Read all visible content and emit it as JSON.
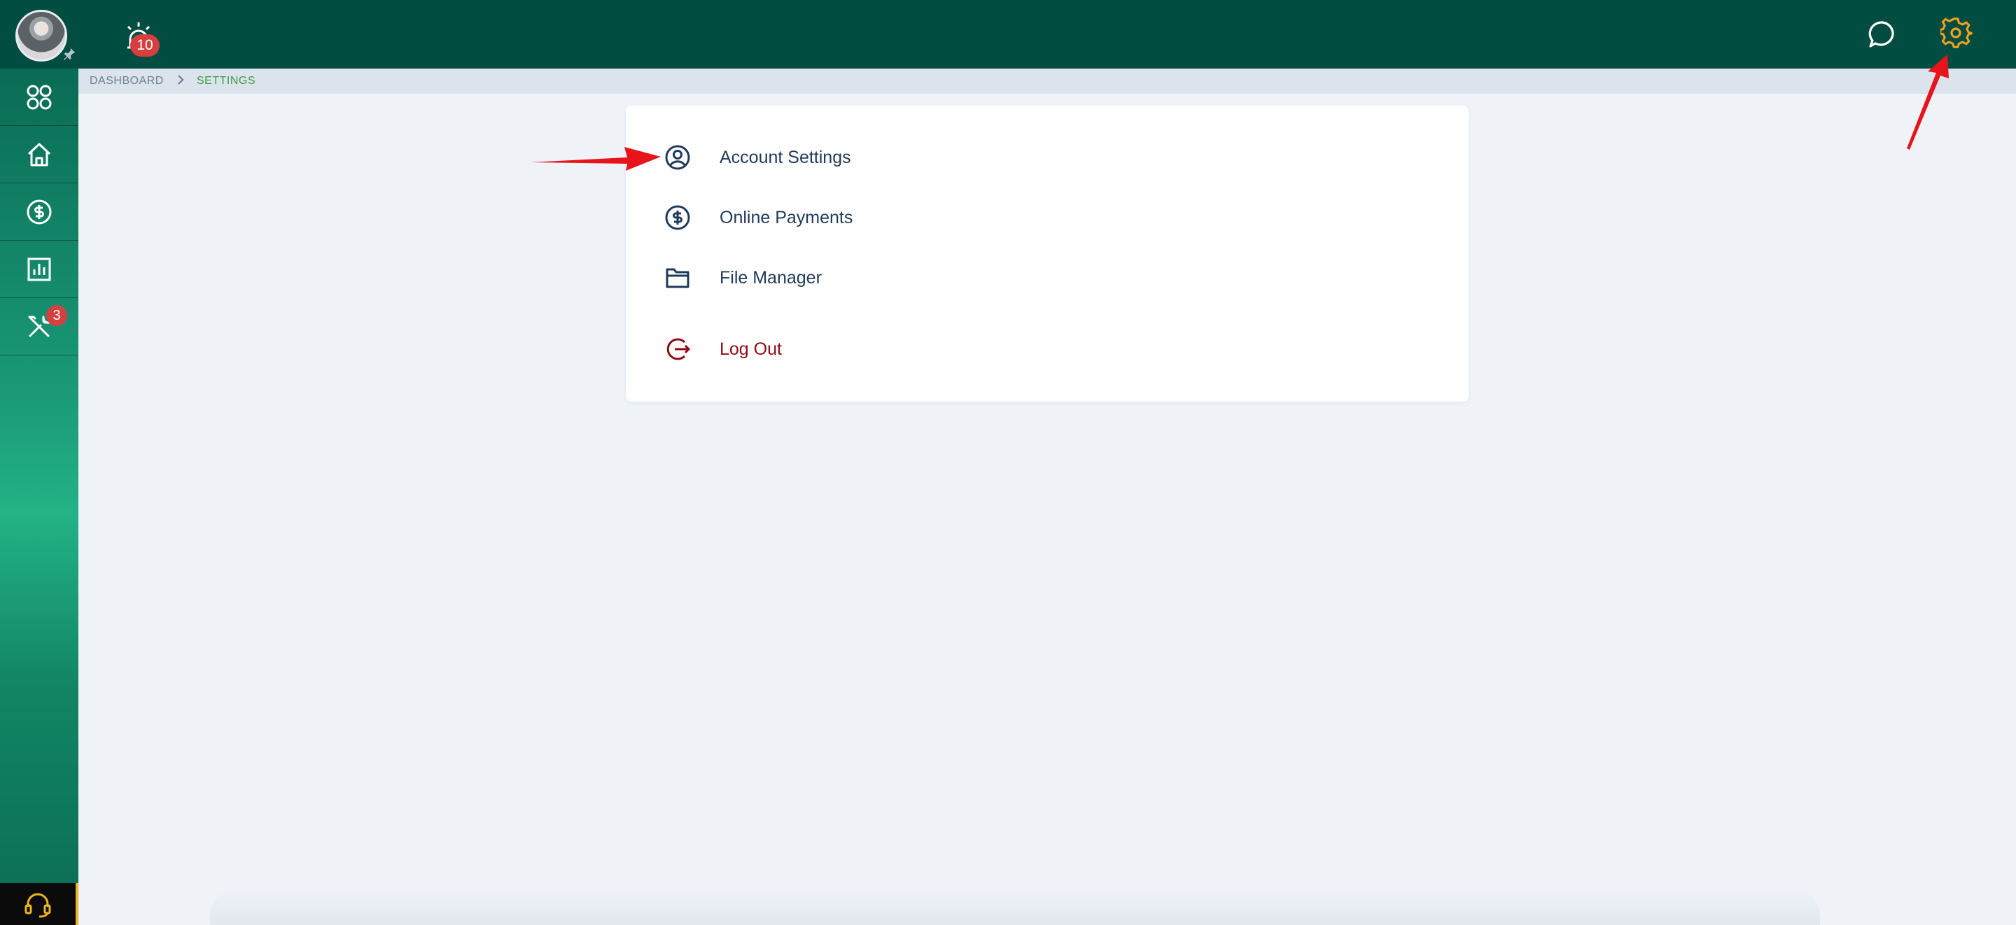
{
  "header": {
    "alarm_badge": "10",
    "icons": [
      "user-avatar",
      "pin-icon",
      "alarm-icon",
      "chat-icon",
      "gear-icon"
    ],
    "colors": {
      "background": "#024d41",
      "gear_active": "#f0a11f",
      "badge": "#d63f3f"
    }
  },
  "sidebar": {
    "items": [
      {
        "icon": "apps-grid-icon"
      },
      {
        "icon": "home-icon"
      },
      {
        "icon": "dollar-circle-icon"
      },
      {
        "icon": "bar-chart-icon"
      },
      {
        "icon": "tools-icon",
        "badge": "3"
      }
    ],
    "support_icon": "headset-icon"
  },
  "breadcrumb": {
    "items": [
      "DASHBOARD",
      "SETTINGS"
    ]
  },
  "settings_menu": {
    "items": [
      {
        "label": "Account Settings",
        "icon": "user-circle-icon"
      },
      {
        "label": "Online Payments",
        "icon": "dollar-circle-icon"
      },
      {
        "label": "File Manager",
        "icon": "folder-icon"
      },
      {
        "label": "Log Out",
        "icon": "logout-icon"
      }
    ],
    "colors": {
      "label": "#1f3a5a",
      "logout": "#8c0c14"
    }
  },
  "annotations": {
    "arrow_color": "#e8141b",
    "arrows": [
      "arrow-to-account-settings",
      "arrow-to-gear"
    ]
  }
}
